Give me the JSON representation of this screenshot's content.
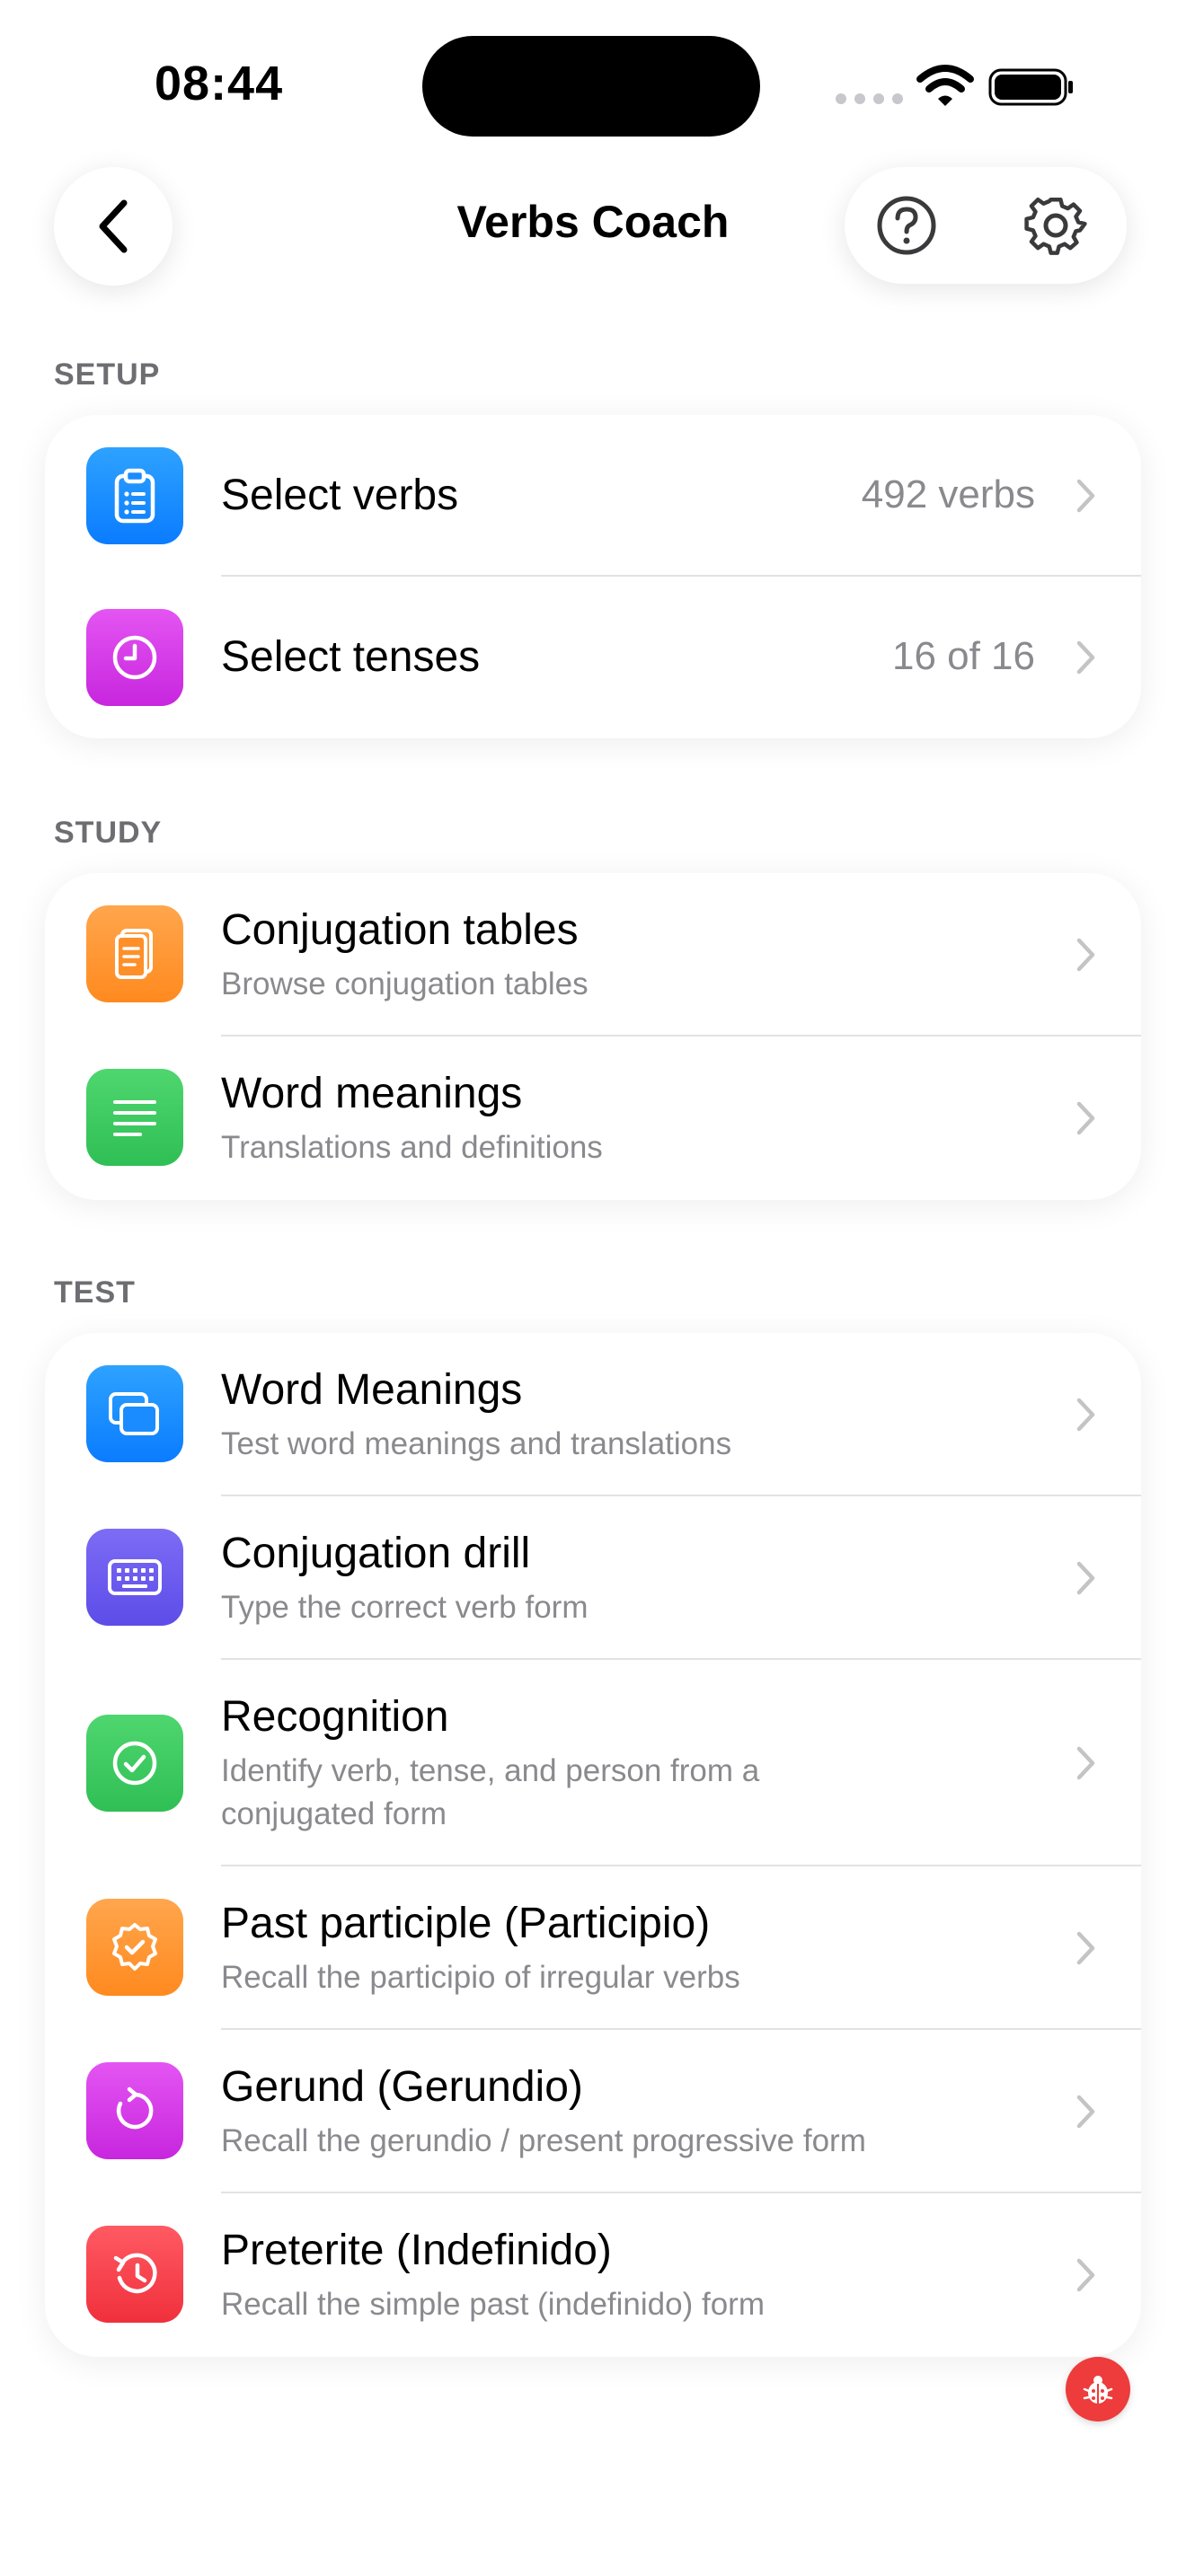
{
  "status_bar": {
    "time": "08:44"
  },
  "nav": {
    "title": "Verbs Coach",
    "back_icon": "chevron-left-icon",
    "help_icon": "question-circle-icon",
    "settings_icon": "gear-icon"
  },
  "sections": {
    "setup": {
      "header": "SETUP",
      "rows": [
        {
          "title": "Select verbs",
          "value": "492 verbs",
          "icon": "clipboard-icon",
          "color": "#1a8cff"
        },
        {
          "title": "Select tenses",
          "value": "16 of 16",
          "icon": "clock-icon",
          "color": "#d63ce8"
        }
      ]
    },
    "study": {
      "header": "STUDY",
      "rows": [
        {
          "title": "Conjugation tables",
          "subtitle": "Browse conjugation tables",
          "icon": "document-icon",
          "color": "#ff9533"
        },
        {
          "title": "Word meanings",
          "subtitle": "Translations and definitions",
          "icon": "text-lines-icon",
          "color": "#34c759"
        }
      ]
    },
    "test": {
      "header": "TEST",
      "rows": [
        {
          "title": "Word Meanings",
          "subtitle": "Test word meanings and translations",
          "icon": "cards-icon",
          "color": "#1a8cff"
        },
        {
          "title": "Conjugation drill",
          "subtitle": "Type the correct verb form",
          "icon": "keyboard-icon",
          "color": "#6b5cf0"
        },
        {
          "title": "Recognition",
          "subtitle": "Identify verb, tense, and person from a conjugated form",
          "icon": "checkmark-circle-icon",
          "color": "#34c759"
        },
        {
          "title": "Past participle (Participio)",
          "subtitle": "Recall the participio of irregular verbs",
          "icon": "seal-check-icon",
          "color": "#ff9533"
        },
        {
          "title": "Gerund (Gerundio)",
          "subtitle": "Recall the gerundio / present progressive form",
          "icon": "arrow-clockwise-icon",
          "color": "#d63ce8"
        },
        {
          "title": "Preterite (Indefinido)",
          "subtitle": "Recall the simple past (indefinido) form",
          "icon": "clock-history-icon",
          "color": "#ff3b47"
        }
      ]
    }
  },
  "debug": {
    "icon": "ladybug-icon",
    "color": "#ee3b3b"
  }
}
